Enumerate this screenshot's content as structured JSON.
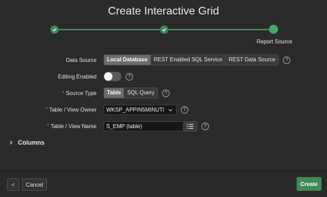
{
  "dialog": {
    "title": "Create Interactive Grid"
  },
  "wizard": {
    "current_step_label": "Report Source"
  },
  "form": {
    "data_source": {
      "label": "Data Source",
      "options": [
        "Local Database",
        "REST Enabled SQL Service",
        "REST Data Source"
      ],
      "selected": "Local Database"
    },
    "editing_enabled": {
      "label": "Editing Enabled",
      "value": false
    },
    "source_type": {
      "label": "Source Type",
      "options": [
        "Table",
        "SQL Query"
      ],
      "selected": "Table"
    },
    "table_owner": {
      "label": "Table / View Owner",
      "value": "WKSP_APPIN5MINUTI"
    },
    "table_name": {
      "label": "Table / View Name",
      "value": "S_EMP (table)"
    }
  },
  "columns_section": {
    "label": "Columns"
  },
  "footer": {
    "back_label": "<",
    "cancel_label": "Cancel",
    "create_label": "Create"
  },
  "help_glyph": "?",
  "colors": {
    "accent_green": "#3f8a55",
    "background": "#2b2a2a",
    "required": "#d9534f"
  }
}
